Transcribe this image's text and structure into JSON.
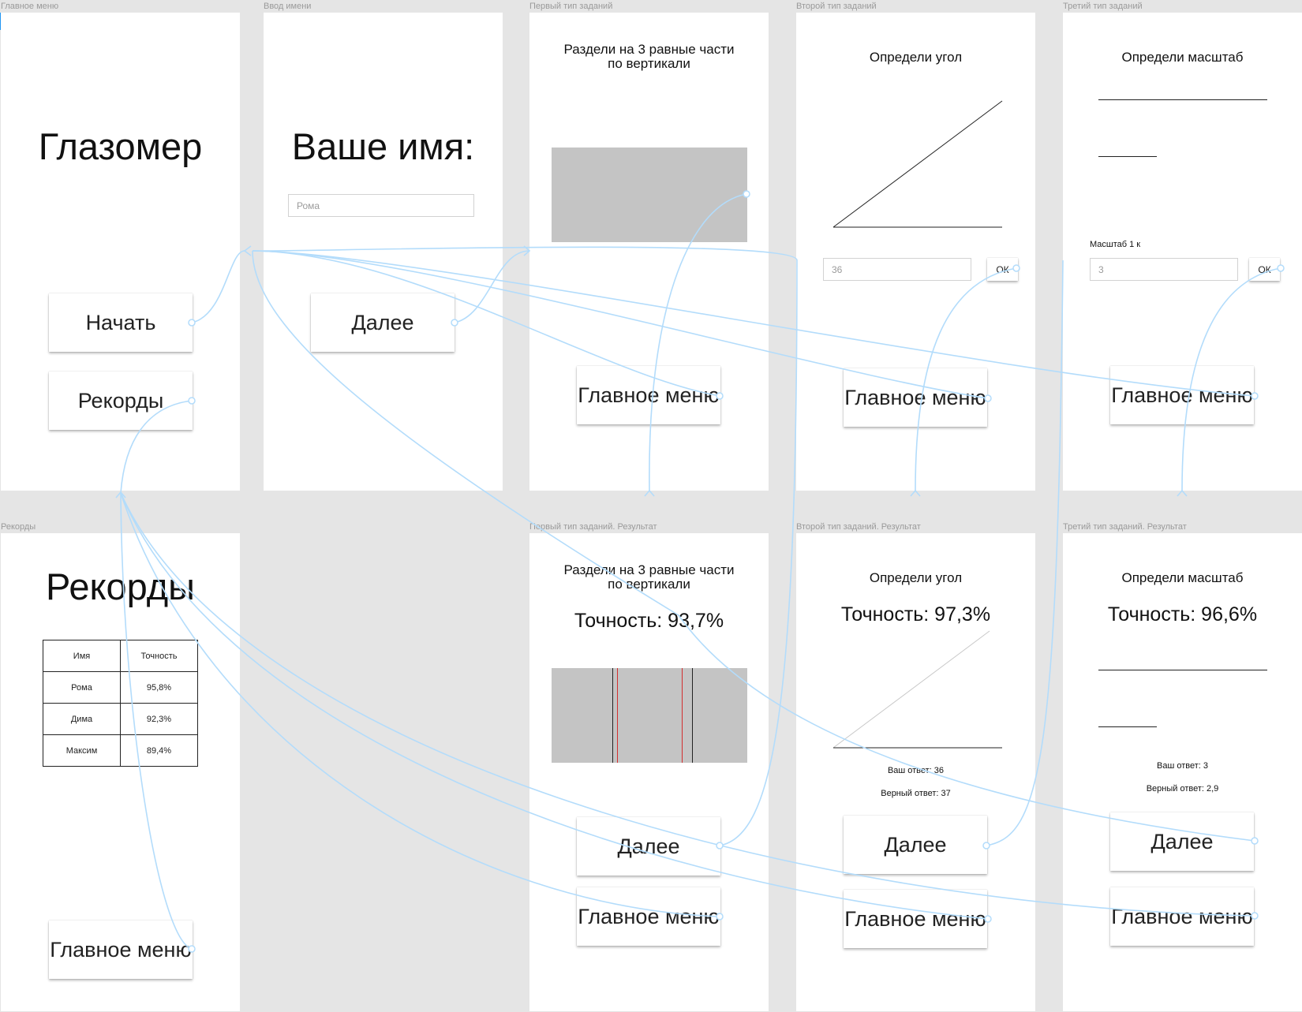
{
  "frames": {
    "main_menu": {
      "label": "Главное меню",
      "title": "Глазомер",
      "start_label": "Начать",
      "records_label": "Рекорды"
    },
    "name_input": {
      "label": "Ввод имени",
      "title": "Ваше имя:",
      "input_value": "Рома",
      "next_label": "Далее"
    },
    "task1": {
      "label": "Первый тип заданий",
      "title_line1": "Раздели на 3 равные части",
      "title_line2": "по вертикали",
      "menu_label": "Главное меню"
    },
    "task2": {
      "label": "Второй тип заданий",
      "title": "Определи угол",
      "input_value": "36",
      "ok_label": "ОК",
      "menu_label": "Главное меню"
    },
    "task3": {
      "label": "Третий тип заданий",
      "title": "Определи масштаб",
      "scale_caption": "Масштаб 1 к",
      "input_value": "3",
      "ok_label": "ОК",
      "menu_label": "Главное меню"
    },
    "records": {
      "label": "Рекорды",
      "title": "Рекорды",
      "headers": [
        "Имя",
        "Точность"
      ],
      "rows": [
        [
          "Рома",
          "95,8%"
        ],
        [
          "Дима",
          "92,3%"
        ],
        [
          "Максим",
          "89,4%"
        ]
      ],
      "menu_label": "Главное меню"
    },
    "task1_result": {
      "label": "Первый тип заданий. Результат",
      "title_line1": "Раздели на 3 равные части",
      "title_line2": "по вертикали",
      "accuracy": "Точность: 93,7%",
      "next_label": "Далее",
      "menu_label": "Главное меню"
    },
    "task2_result": {
      "label": "Второй тип заданий. Результат",
      "title": "Определи угол",
      "accuracy": "Точность: 97,3%",
      "your_answer": "Ваш ответ: 36",
      "correct_answer": "Верный ответ: 37",
      "next_label": "Далее",
      "menu_label": "Главное меню"
    },
    "task3_result": {
      "label": "Третий тип заданий. Результат",
      "title": "Определи масштаб",
      "accuracy": "Точность: 96,6%",
      "your_answer": "Ваш ответ: 3",
      "correct_answer": "Верный ответ: 2,9",
      "next_label": "Далее",
      "menu_label": "Главное меню"
    }
  },
  "colors": {
    "canvas": "#e5e5e5",
    "frame": "#ffffff",
    "gray_block": "#c4c4c4",
    "connector": "#b3dcfb",
    "user_line": "#d32f2f"
  }
}
